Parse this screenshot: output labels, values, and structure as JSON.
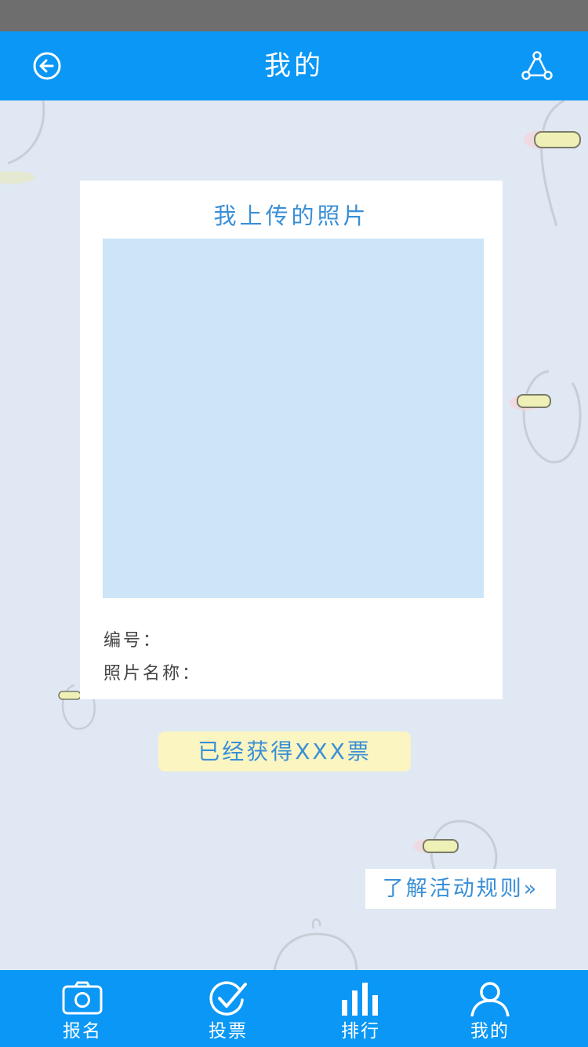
{
  "header": {
    "title": "我的",
    "back_icon": "back-arrow-icon",
    "share_icon": "share-icon"
  },
  "card": {
    "title": "我上传的照片",
    "number_label": "编号：",
    "name_label": "照片名称："
  },
  "votes_text": "已经获得XXX票",
  "rules_link": "了解活动规则»",
  "tabs": [
    {
      "label": "报名",
      "icon": "camera-icon"
    },
    {
      "label": "投票",
      "icon": "check-circle-icon"
    },
    {
      "label": "排行",
      "icon": "bar-chart-icon"
    },
    {
      "label": "我的",
      "icon": "user-icon"
    }
  ],
  "colors": {
    "accent": "#0a97f5",
    "background": "#dfe8f3",
    "text_blue": "#3a8fd6",
    "photo_placeholder": "#cce5f8",
    "badge": "#fbf5c2"
  }
}
